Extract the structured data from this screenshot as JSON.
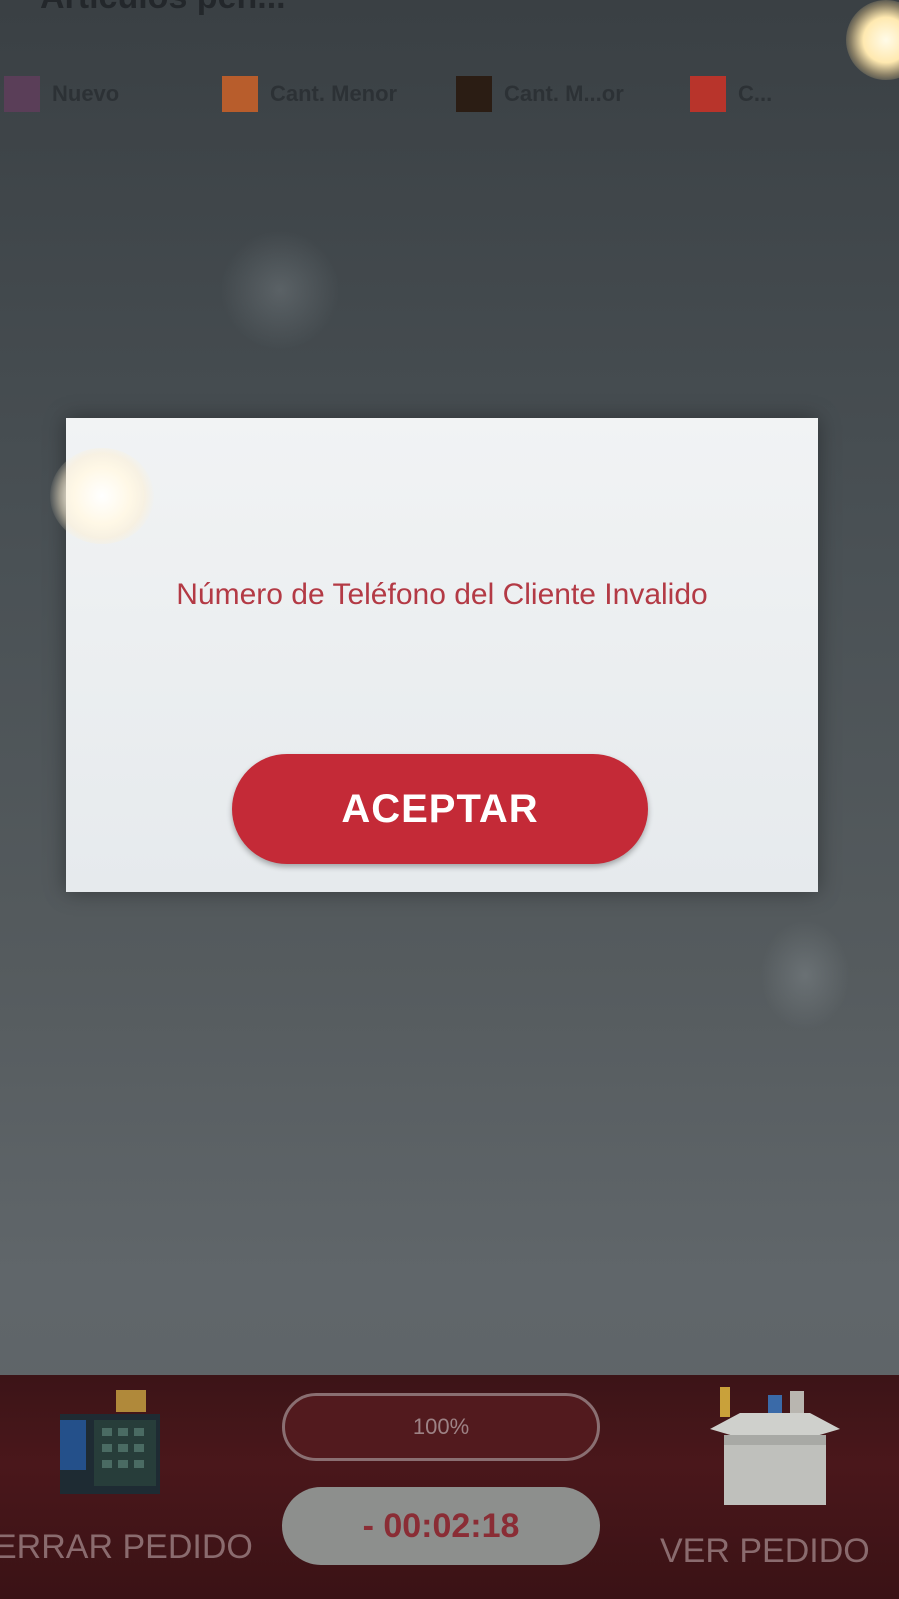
{
  "header": {
    "title": "Artículos pen..."
  },
  "legend": {
    "items": [
      {
        "label": "Nuevo",
        "color": "#5a3e58"
      },
      {
        "label": "Cant. Menor",
        "color": "#b85d2c"
      },
      {
        "label": "Cant. M...or",
        "color": "#2b1d14"
      },
      {
        "label": "C...",
        "color": "#b8342b"
      }
    ]
  },
  "dialog": {
    "message": "Número de Teléfono del Cliente Invalido",
    "accept_label": "ACEPTAR",
    "message_color": "#b33a45",
    "button_color": "#c42a37"
  },
  "bottom_bar": {
    "close_order_label": "ERRAR PEDIDO",
    "progress": "100%",
    "timer": "- 00:02:18",
    "view_order_label": "VER PEDIDO",
    "bar_color": "#4a171b"
  },
  "icons": {
    "close_order": "cash-register-icon",
    "view_order": "box-icon"
  }
}
